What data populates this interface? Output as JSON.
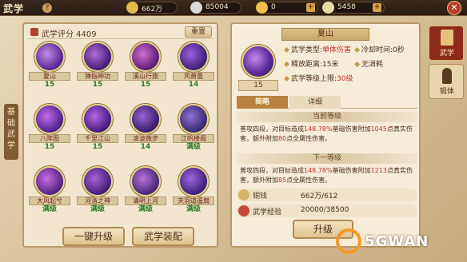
{
  "header": {
    "title": "武学",
    "help_icon": "?",
    "resources": [
      {
        "name": "coin",
        "value": "662万",
        "color": "#e2b84f"
      },
      {
        "name": "silver",
        "value": "85004",
        "color": "#d9d9d9"
      },
      {
        "name": "gold-ingot",
        "value": "0",
        "color": "#f0c04a"
      },
      {
        "name": "silver-ingot",
        "value": "5458",
        "color": "#e8d9a8"
      }
    ],
    "plus": "+",
    "close": "✕"
  },
  "left_tab": "基础武学",
  "score": {
    "label": "武学评分 4409",
    "reset": "重置"
  },
  "skills": [
    {
      "name": "夏山",
      "level": "15",
      "c1": "#c48be8",
      "c2": "#4c1c8a"
    },
    {
      "name": "弹指神功",
      "level": "15",
      "c1": "#b06bd8",
      "c2": "#3d1670"
    },
    {
      "name": "溪山行旅",
      "level": "15",
      "c1": "#d06fcf",
      "c2": "#51176e"
    },
    {
      "name": "风萧凰",
      "level": "14",
      "c1": "#9e5fe0",
      "c2": "#361a6c"
    },
    {
      "name": "八阵图",
      "level": "15",
      "c1": "#c06ce8",
      "c2": "#461b85"
    },
    {
      "name": "千里江山",
      "level": "15",
      "c1": "#b565e2",
      "c2": "#3a1577"
    },
    {
      "name": "凌波微步",
      "level": "14",
      "c1": "#9a63d6",
      "c2": "#2e1860"
    },
    {
      "name": "江帆楼阁",
      "level": "满级",
      "c1": "#8f70d8",
      "c2": "#2f2264"
    },
    {
      "name": "大风起兮",
      "level": "满级",
      "c1": "#c76fe0",
      "c2": "#4a1a7c"
    },
    {
      "name": "河洛之神",
      "level": "满级",
      "c1": "#a862d6",
      "c2": "#3c1870"
    },
    {
      "name": "清明上河",
      "level": "满级",
      "c1": "#b774d8",
      "c2": "#40206e"
    },
    {
      "name": "天羽道遥扇",
      "level": "满级",
      "c1": "#9f66df",
      "c2": "#361a70"
    }
  ],
  "buttons": {
    "one_key": "一键升级",
    "equip": "武学装配",
    "upgrade": "升级"
  },
  "detail": {
    "title": "夏山",
    "level": "15",
    "type_label": "武学类型:",
    "type_value": "单体伤害",
    "cd_label": "冷却时间:",
    "cd_value": "0秒",
    "range_label": "释放距离:",
    "range_value": "15米",
    "cost": "无消耗",
    "max_label": "武学等级上限:",
    "max_value": "30级",
    "tabs": [
      "简略",
      "详细"
    ],
    "current_head": "当前等级",
    "current_desc_a": "普攻四段，对目标造成",
    "current_pct": "148.78%",
    "current_desc_b": "基础伤害附加",
    "current_add": "1045",
    "current_desc_c": "点真实伤害，额外附加",
    "current_extra": "80",
    "current_desc_d": "点全属性伤害。",
    "next_head": "下一等级",
    "next_desc_a": "普攻四段，对目标造成",
    "next_pct": "148.78%",
    "next_desc_b": "基础伤害附加",
    "next_add": "1213",
    "next_desc_c": "点真实伤害，额外附加",
    "next_extra": "85",
    "next_desc_d": "点全属性伤害。",
    "copper_label": "铜钱",
    "copper_value": "662万/612",
    "exp_label": "武学经验",
    "exp_value": "20000/38500"
  },
  "side_tabs": [
    {
      "label": "武学"
    },
    {
      "label": "锻体"
    }
  ],
  "watermark": "5GWAN"
}
